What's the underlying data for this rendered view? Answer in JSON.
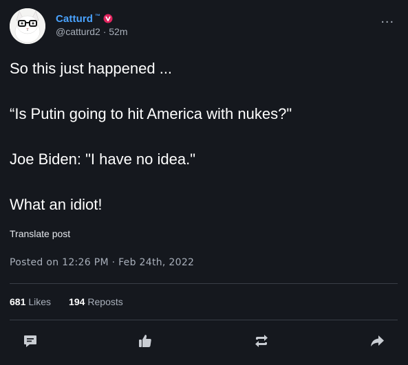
{
  "post": {
    "author": {
      "display_name": "Catturd",
      "trademark": "™",
      "handle": "@catturd2",
      "time_ago": "52m",
      "separator": "·"
    },
    "menu_label": "...",
    "paragraphs": [
      "So this just happened ...",
      "“Is Putin going to hit America with nukes?\"",
      "Joe Biden: \"I have no idea.\"",
      "What an idiot!"
    ],
    "translate_label": "Translate post",
    "posted_on": "Posted on 12:26 PM · Feb 24th, 2022",
    "stats": {
      "likes_count": "681",
      "likes_label": "Likes",
      "reposts_count": "194",
      "reposts_label": "Reposts"
    },
    "actions": [
      "comment-icon",
      "like-icon",
      "repost-icon",
      "share-icon"
    ],
    "colors": {
      "background": "#15181e",
      "accent": "#4aa3ff",
      "verified": "#e0245e",
      "muted": "#a9b0bb",
      "divider": "#3a3f47"
    }
  }
}
